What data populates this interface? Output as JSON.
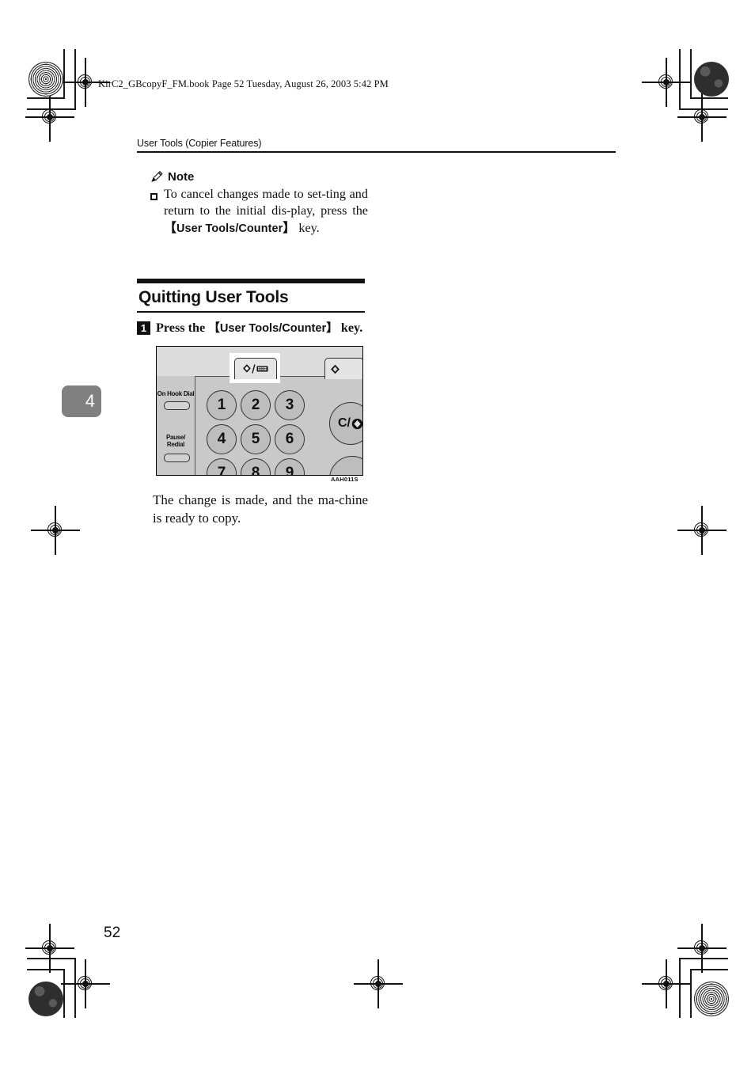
{
  "document": {
    "book_line": "KirC2_GBcopyF_FM.book  Page 52  Tuesday, August 26, 2003  5:42 PM",
    "running_header": "User Tools (Copier Features)",
    "page_number": "52",
    "chapter_tab": "4"
  },
  "note": {
    "icon": "pencil-icon",
    "label": "Note",
    "bullet": "hollow-square-bullet",
    "text_part1": "To cancel changes made to set-ting and return to the initial dis-play, press the ",
    "bracket_open": "【",
    "key_name": "User Tools/Counter",
    "bracket_close": "】",
    "text_part2": " key."
  },
  "section": {
    "title": "Quitting User Tools"
  },
  "step": {
    "number": "1",
    "text_before": "Press the ",
    "bracket_open": "【",
    "key_name": "User Tools/Counter",
    "bracket_close": "】",
    "text_after": " key."
  },
  "figure": {
    "caption": "AAH011S",
    "user_tools_counter_button": "user-tools-counter-icon",
    "right_button": "diamond-icon",
    "left_labels": [
      {
        "label": "On Hook Dial"
      },
      {
        "label": "Pause/\nRedial"
      }
    ],
    "on_hook_dial_label": "On Hook Dial",
    "pause_redial_label_1": "Pause/",
    "pause_redial_label_2": "Redial",
    "numeric_keys": [
      "1",
      "2",
      "3",
      "4",
      "5",
      "6",
      "7",
      "8",
      "9"
    ],
    "clear_key": "C/",
    "clear_key_icon": "stop-diamond-icon"
  },
  "after_paragraph": {
    "text": "The change is made, and the ma-chine is ready to copy."
  },
  "colors": {
    "ink": "#111111",
    "chapter_tab_bg": "#808080",
    "panel_bg": "#c9c9c9",
    "panel_top_bg": "#dcdcdc",
    "key_bg": "#bdbdbd"
  }
}
